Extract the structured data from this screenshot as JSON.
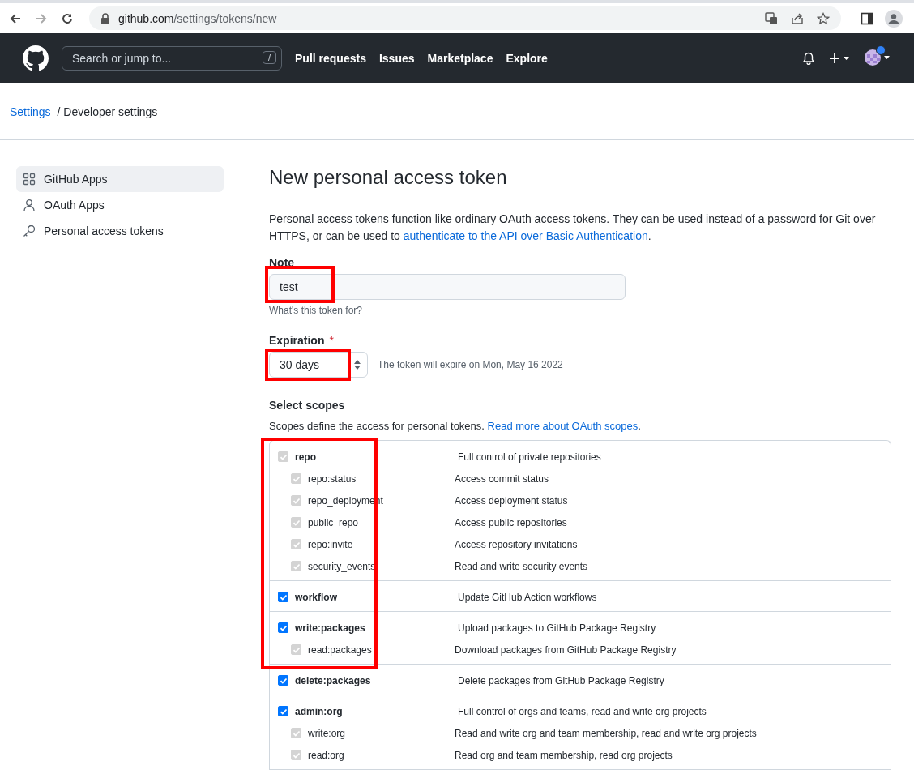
{
  "browser": {
    "url_host": "github.com",
    "url_path": "/settings/tokens/new"
  },
  "header": {
    "search": {
      "placeholder": "Search or jump to...",
      "shortcut": "/"
    },
    "nav": [
      "Pull requests",
      "Issues",
      "Marketplace",
      "Explore"
    ],
    "has_notification": true
  },
  "breadcrumb": [
    {
      "label": "Settings",
      "link": true
    },
    {
      "label": "/ Developer settings",
      "link": false
    }
  ],
  "sidebar": {
    "items": [
      {
        "label": "GitHub Apps",
        "selected": true
      },
      {
        "label": "OAuth Apps",
        "selected": false
      },
      {
        "label": "Personal access tokens",
        "selected": false
      }
    ]
  },
  "main": {
    "title": "New personal access token",
    "intro": "Personal access tokens function like ordinary OAuth access tokens. They can be used instead of a password for Git over HTTPS, or can be used to ",
    "intro_link": "authenticate to the API over Basic Authentication",
    "intro_end": ".",
    "note": {
      "label": "Note",
      "value": "test",
      "hint": "What's this token for?",
      "highlighted": true
    },
    "expiration": {
      "label": "Expiration",
      "required": "*",
      "value": "30 days",
      "info": "The token will expire on Mon, May 16 2022",
      "highlighted": true
    },
    "scopes": {
      "title": "Select scopes",
      "intro": "Scopes define the access for personal tokens. ",
      "intro_link": "Read more about OAuth scopes",
      "intro_end": ".",
      "groups": [
        {
          "name": "repo",
          "description": "Full control of private repositories",
          "checked": true,
          "disabled": true,
          "highlighted": true,
          "children": [
            {
              "name": "repo:status",
              "description": "Access commit status",
              "checked": true,
              "disabled": true
            },
            {
              "name": "repo_deployment",
              "description": "Access deployment status",
              "checked": true,
              "disabled": true
            },
            {
              "name": "public_repo",
              "description": "Access public repositories",
              "checked": true,
              "disabled": true
            },
            {
              "name": "repo:invite",
              "description": "Access repository invitations",
              "checked": true,
              "disabled": true
            },
            {
              "name": "security_events",
              "description": "Read and write security events",
              "checked": true,
              "disabled": true
            }
          ]
        },
        {
          "name": "workflow",
          "description": "Update GitHub Action workflows",
          "checked": true,
          "disabled": false,
          "highlighted": true
        },
        {
          "name": "write:packages",
          "description": "Upload packages to GitHub Package Registry",
          "checked": true,
          "disabled": false,
          "highlighted": true,
          "children": [
            {
              "name": "read:packages",
              "description": "Download packages from GitHub Package Registry",
              "checked": true,
              "disabled": true
            }
          ]
        },
        {
          "name": "delete:packages",
          "description": "Delete packages from GitHub Package Registry",
          "checked": true,
          "disabled": false
        },
        {
          "name": "admin:org",
          "description": "Full control of orgs and teams, read and write org projects",
          "checked": true,
          "disabled": false,
          "children": [
            {
              "name": "write:org",
              "description": "Read and write org and team membership, read and write org projects",
              "checked": true,
              "disabled": true
            },
            {
              "name": "read:org",
              "description": "Read org and team membership, read org projects",
              "checked": true,
              "disabled": true
            }
          ]
        }
      ]
    }
  }
}
